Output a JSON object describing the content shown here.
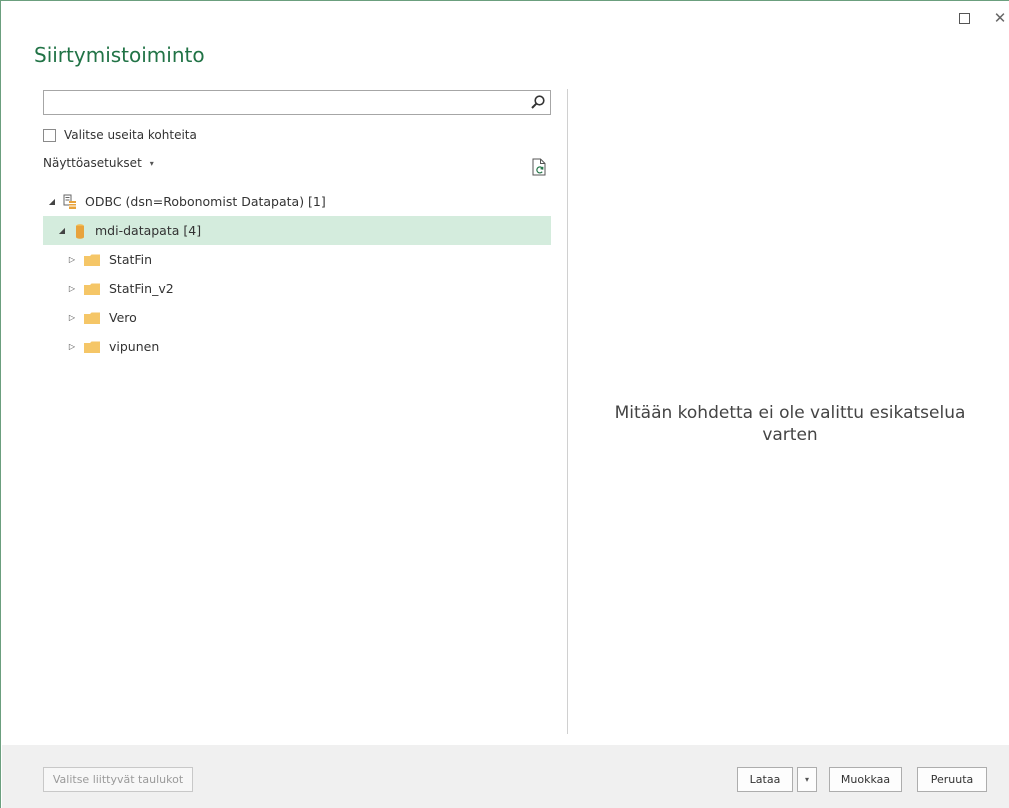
{
  "window": {
    "title": "Siirtymistoiminto",
    "maximize_icon": "maximize-icon",
    "close_icon": "close-icon",
    "close_glyph": "✕"
  },
  "navigator": {
    "search": {
      "value": "",
      "placeholder": ""
    },
    "multi_select_label": "Valitse useita kohteita",
    "multi_select_checked": false,
    "display_options_label": "Näyttöasetukset",
    "display_options_caret": "▾",
    "tree": [
      {
        "label": "ODBC (dsn=Robonomist Datapata) [1]",
        "icon": "odbc-server-icon",
        "expander": "◢",
        "level": 0,
        "selected": false
      },
      {
        "label": "mdi-datapata [4]",
        "icon": "database-icon",
        "expander": "◢",
        "level": 1,
        "selected": true
      },
      {
        "label": "StatFin",
        "icon": "folder-icon",
        "expander": "▷",
        "level": 2,
        "selected": false
      },
      {
        "label": "StatFin_v2",
        "icon": "folder-icon",
        "expander": "▷",
        "level": 2,
        "selected": false
      },
      {
        "label": "Vero",
        "icon": "folder-icon",
        "expander": "▷",
        "level": 2,
        "selected": false
      },
      {
        "label": "vipunen",
        "icon": "folder-icon",
        "expander": "▷",
        "level": 2,
        "selected": false
      }
    ]
  },
  "preview": {
    "empty_message": "Mitään kohdetta ei ole valittu esikatselua varten"
  },
  "footer": {
    "related_tables_label": "Valitse liittyvät taulukot",
    "load_label": "Lataa",
    "load_arrow": "▾",
    "edit_label": "Muokkaa",
    "cancel_label": "Peruuta"
  },
  "colors": {
    "title_green": "#217346",
    "selected_row": "#d4ecdd",
    "folder": "#f5c667",
    "database": "#e8a33c"
  }
}
